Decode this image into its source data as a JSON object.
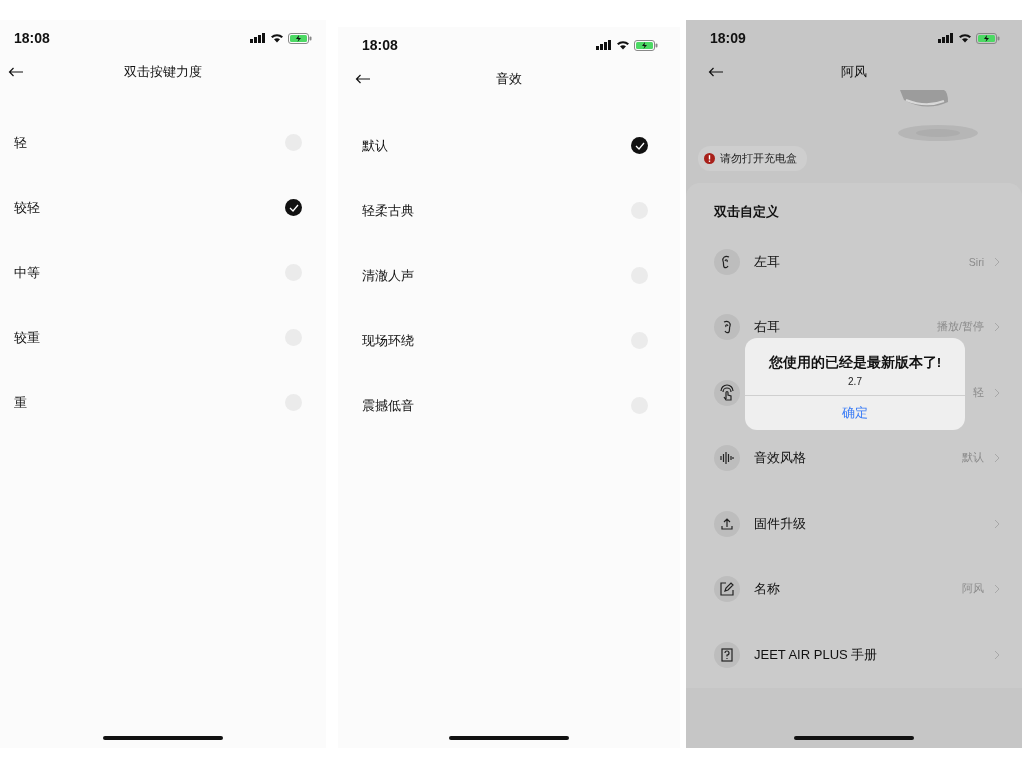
{
  "screens": [
    {
      "kind": "options",
      "status_bar": {
        "time": "18:08"
      },
      "title": "双击按键力度",
      "options": [
        {
          "label": "轻",
          "selected": false
        },
        {
          "label": "较轻",
          "selected": true
        },
        {
          "label": "中等",
          "selected": false
        },
        {
          "label": "较重",
          "selected": false
        },
        {
          "label": "重",
          "selected": false
        }
      ]
    },
    {
      "kind": "options",
      "status_bar": {
        "time": "18:08"
      },
      "title": "音效",
      "options": [
        {
          "label": "默认",
          "selected": true
        },
        {
          "label": "轻柔古典",
          "selected": false
        },
        {
          "label": "清澈人声",
          "selected": false
        },
        {
          "label": "现场环绕",
          "selected": false
        },
        {
          "label": "震撼低音",
          "selected": false
        }
      ]
    },
    {
      "kind": "device",
      "status_bar": {
        "time": "18:09"
      },
      "title": "阿风",
      "warning": "请勿打开充电盒",
      "card": {
        "title": "双击自定义",
        "rows": [
          {
            "label": "左耳",
            "value": "Siri"
          },
          {
            "label": "右耳",
            "value": "播放/暂停"
          },
          {
            "value": "轻"
          },
          {
            "label": "音效风格",
            "value": "默认"
          },
          {
            "label": "固件升级"
          },
          {
            "label": "名称",
            "value": "阿风"
          },
          {
            "label": "JEET AIR PLUS 手册"
          }
        ]
      },
      "dialog": {
        "title": "您使用的已经是最新版本了!",
        "message": "2.7",
        "button": "确定"
      }
    }
  ]
}
